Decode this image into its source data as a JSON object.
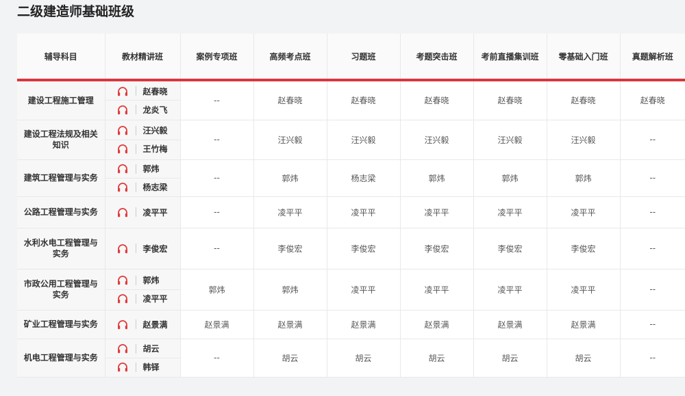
{
  "page": {
    "title": "二级建造师基础班级"
  },
  "colors": {
    "accent": "#d9363e",
    "icon": "#e03c3c"
  },
  "table": {
    "headers": [
      "辅导科目",
      "教材精讲班",
      "案例专项班",
      "高频考点班",
      "习题班",
      "考题突击班",
      "考前直播集训班",
      "零基础入门班",
      "真题解析班"
    ],
    "rows": [
      {
        "subject": "建设工程施工管理",
        "lecturers": [
          "赵春晓",
          "龙炎飞"
        ],
        "cells": [
          "--",
          "赵春晓",
          "赵春晓",
          "赵春晓",
          "赵春晓",
          "赵春晓",
          "赵春晓"
        ]
      },
      {
        "subject": "建设工程法规及相关知识",
        "lecturers": [
          "汪兴毅",
          "王竹梅"
        ],
        "cells": [
          "--",
          "汪兴毅",
          "汪兴毅",
          "汪兴毅",
          "汪兴毅",
          "汪兴毅",
          "--"
        ]
      },
      {
        "subject": "建筑工程管理与实务",
        "lecturers": [
          "郭炜",
          "杨志梁"
        ],
        "cells": [
          "--",
          "郭炜",
          "杨志梁",
          "郭炜",
          "郭炜",
          "郭炜",
          "--"
        ]
      },
      {
        "subject": "公路工程管理与实务",
        "lecturers": [
          "凌平平"
        ],
        "cells": [
          "--",
          "凌平平",
          "凌平平",
          "凌平平",
          "凌平平",
          "凌平平",
          "--"
        ]
      },
      {
        "subject": "水利水电工程管理与实务",
        "lecturers": [
          "李俊宏"
        ],
        "cells": [
          "--",
          "李俊宏",
          "李俊宏",
          "李俊宏",
          "李俊宏",
          "李俊宏",
          "--"
        ]
      },
      {
        "subject": "市政公用工程管理与实务",
        "lecturers": [
          "郭炜",
          "凌平平"
        ],
        "cells": [
          "郭炜",
          "郭炜",
          "凌平平",
          "凌平平",
          "凌平平",
          "凌平平",
          "--"
        ]
      },
      {
        "subject": "矿业工程管理与实务",
        "lecturers": [
          "赵景满"
        ],
        "cells": [
          "赵景满",
          "赵景满",
          "赵景满",
          "赵景满",
          "赵景满",
          "赵景满",
          "--"
        ]
      },
      {
        "subject": "机电工程管理与实务",
        "lecturers": [
          "胡云",
          "韩铎"
        ],
        "cells": [
          "--",
          "胡云",
          "胡云",
          "胡云",
          "胡云",
          "胡云",
          "--"
        ]
      }
    ]
  }
}
